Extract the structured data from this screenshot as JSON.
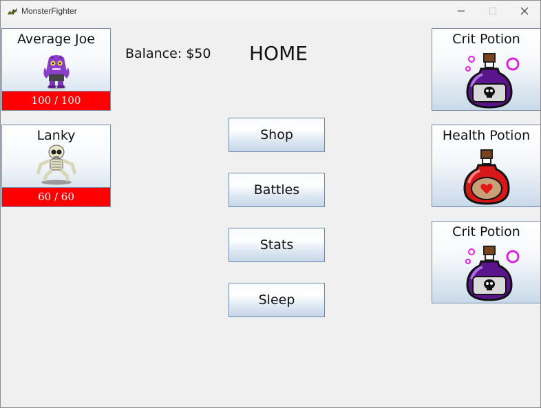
{
  "window": {
    "title": "MonsterFighter",
    "icon": "dragon-icon"
  },
  "colors": {
    "hp_bar": "#ff0000",
    "window_bg": "#f0f0f0",
    "button_border": "#6d88a8"
  },
  "monsters": [
    {
      "name": "Average Joe",
      "hp": "100 / 100",
      "icon": "purple-troll-monster"
    },
    {
      "name": "Lanky",
      "hp": "60 / 60",
      "icon": "skeleton-monster"
    }
  ],
  "status": {
    "balance": "Balance: $50"
  },
  "page": {
    "title": "HOME"
  },
  "menu": [
    {
      "label": "Shop"
    },
    {
      "label": "Battles"
    },
    {
      "label": "Stats"
    },
    {
      "label": "Sleep"
    }
  ],
  "inventory": [
    {
      "name": "Crit Potion",
      "icon": "purple-potion-icon"
    },
    {
      "name": "Health Potion",
      "icon": "red-heart-potion-icon"
    },
    {
      "name": "Crit Potion",
      "icon": "purple-potion-icon"
    }
  ]
}
